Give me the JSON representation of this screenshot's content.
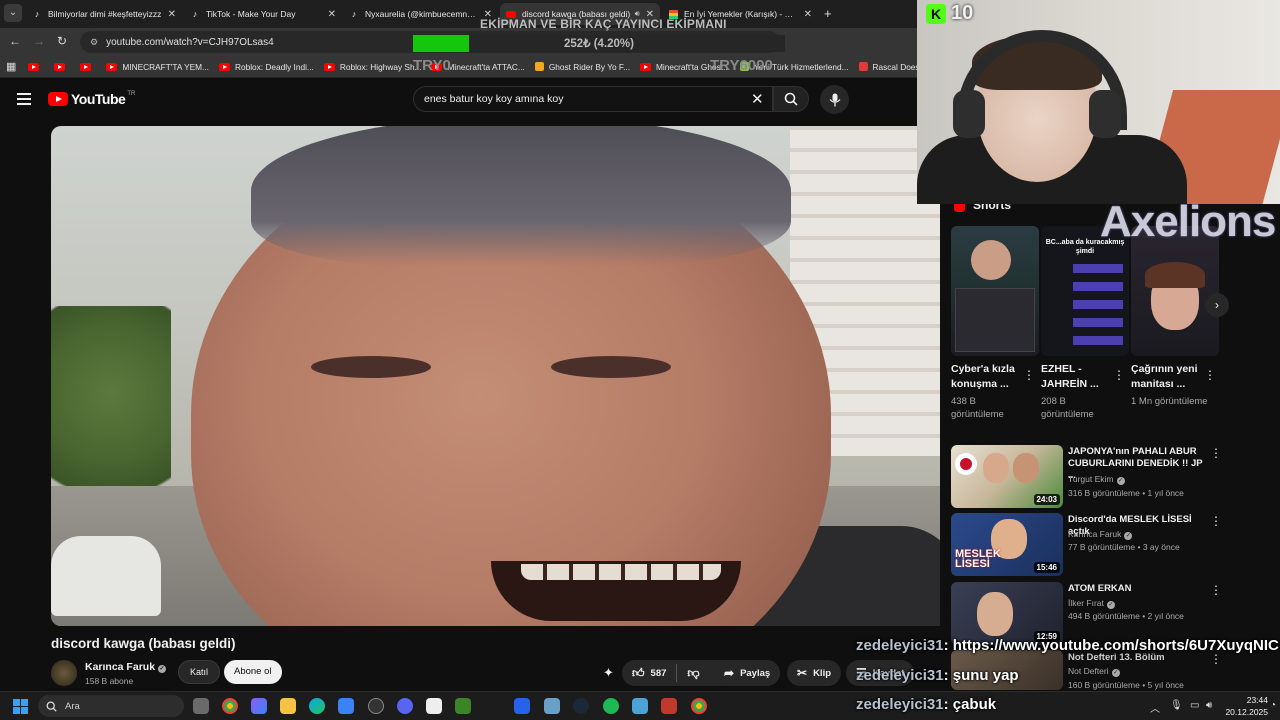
{
  "browser": {
    "tabs": [
      {
        "label": "Bilmiyorlar dimi #keşfetteyizzz",
        "icon": "tiktok-icon",
        "active": false
      },
      {
        "label": "TikTok - Make Your Day",
        "icon": "tiktok-icon",
        "active": false
      },
      {
        "label": "Nyxaurelia (@kimbuecemnaz)",
        "icon": "tiktok-icon",
        "active": false
      },
      {
        "label": "discord kawga (babası geldi)",
        "icon": "youtube-icon",
        "active": true
      },
      {
        "label": "En İyi Yemekler (Karışık) - Tier L",
        "icon": "tierlist-icon",
        "active": false
      }
    ],
    "url": "youtube.com/watch?v=CJH97OLsas4",
    "bookmarks": [
      {
        "label": "",
        "icon": "youtube-icon"
      },
      {
        "label": "",
        "icon": "youtube-icon"
      },
      {
        "label": "",
        "icon": "youtube-icon"
      },
      {
        "label": "MINECRAFT'TA YEM...",
        "icon": "youtube-icon"
      },
      {
        "label": "Roblox: Deadly Indi...",
        "icon": "youtube-icon"
      },
      {
        "label": "Roblox: Highway Sh...",
        "icon": "youtube-icon"
      },
      {
        "label": "Minecraft'ta ATTAC...",
        "icon": "youtube-icon"
      },
      {
        "label": "Ghost Rider By Yo F...",
        "icon": "gamebanana-icon"
      },
      {
        "label": "Minecraft'ta Ghost...",
        "icon": "youtube-icon"
      },
      {
        "label": "Yeni Türk Hizmetlerlend...",
        "icon": "mod-icon"
      },
      {
        "label": "Rascal Does Not Dr...",
        "icon": "red-icon"
      }
    ]
  },
  "donation_goal": {
    "title": "EKİPMAN VE BİR KAÇ YAYINCI EKİPMANI",
    "progress_text": "252₺ (4.20%)",
    "progress": 0.042,
    "min_label": "TRY0",
    "max_label": "TRY6000"
  },
  "youtube": {
    "region": "TR",
    "logo_text": "YouTube",
    "search_query": "enes batur koy koy amına koy",
    "video_title": "discord kawga (babası geldi)",
    "channel": {
      "name": "Karınca Faruk",
      "subs": "158 B abone"
    },
    "join_label": "Katıl",
    "subscribe_label": "Abone ol",
    "likes": "587",
    "share_label": "Paylaş",
    "clip_label": "Klip",
    "save_label": "Kaydet",
    "shorts_header": "Shorts",
    "shorts": [
      {
        "title": "Cyber'a kızla konuşma ...",
        "views": "438 B görüntüleme"
      },
      {
        "title": "EZHEL - JAHREİN ...",
        "views": "208 B görüntüleme"
      },
      {
        "title": "Çağrının yeni manitası ...",
        "views": "1 Mn görüntüleme"
      }
    ],
    "short_thumb_caption": "BC...aba da kuracakmış şimdi",
    "recommendations": [
      {
        "title": "JAPONYA'nın PAHALI ABUR CUBURLARINI DENEDİK !! JP ...",
        "channel": "Turgut Ekim",
        "views": "316 B görüntüleme",
        "age": "1 yıl önce",
        "duration": "24:03"
      },
      {
        "title": "Discord'da MESLEK LİSESİ açtık",
        "channel": "Karınca Faruk",
        "views": "77 B görüntüleme",
        "age": "3 ay önce",
        "duration": "15:46",
        "thumb_text": "MESLEK LİSESİ"
      },
      {
        "title": "ATOM ERKAN",
        "channel": "İlker Fırat",
        "views": "494 B görüntüleme",
        "age": "2 yıl önce",
        "duration": "12:59"
      },
      {
        "title": "Not Defteri 13. Bölüm",
        "channel": "Not Defteri",
        "views": "160 B görüntüleme",
        "age": "5 yıl önce",
        "duration": ""
      }
    ]
  },
  "overlay": {
    "kick_viewers": "10",
    "kick_logo": "K",
    "axelions": "Axelions",
    "chat": [
      {
        "user": "zedeleyici31",
        "message": ": https://www.youtube.com/shorts/6U7XuyqNIC"
      },
      {
        "user": "zedeleyici31",
        "message": ": şunu yap"
      },
      {
        "user": "zedeleyici31",
        "message": ": çabuk"
      }
    ]
  },
  "taskbar": {
    "search_placeholder": "Ara",
    "time": "23:44",
    "date": "20.12.2025"
  },
  "colors": {
    "youtube_red": "#ff0000",
    "kick_green": "#53fc18",
    "donation_fill": "#16c60c",
    "background": "#0f0f0f"
  }
}
